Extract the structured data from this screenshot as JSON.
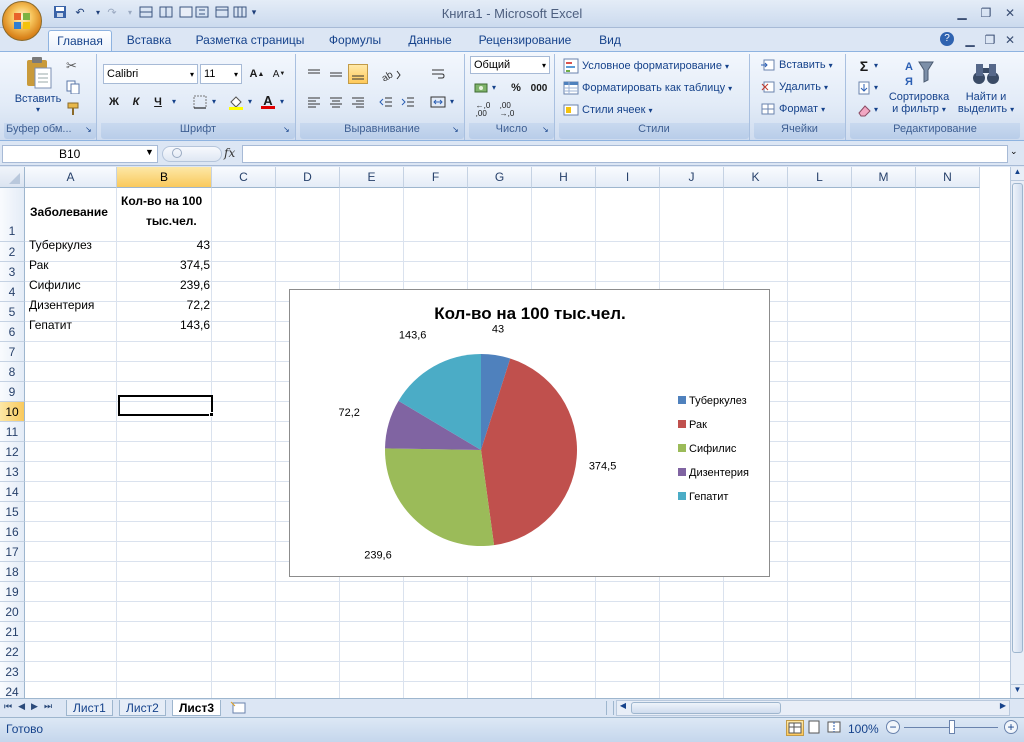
{
  "window": {
    "title": "Книга1 - Microsoft Excel"
  },
  "ribbon_tabs": [
    "Главная",
    "Вставка",
    "Разметка страницы",
    "Формулы",
    "Данные",
    "Рецензирование",
    "Вид"
  ],
  "ribbon": {
    "clipboard": {
      "paste": "Вставить",
      "label": "Буфер обм..."
    },
    "font": {
      "name": "Calibri",
      "size": "11",
      "bold": "Ж",
      "italic": "К",
      "underline": "Ч",
      "label": "Шрифт"
    },
    "alignment": {
      "label": "Выравнивание"
    },
    "number": {
      "format": "Общий",
      "percent": "%",
      "thousands": "000",
      "label": "Число"
    },
    "styles": {
      "conditional": "Условное форматирование",
      "as_table": "Форматировать как таблицу",
      "cell_styles": "Стили ячеек",
      "label": "Стили"
    },
    "cells": {
      "insert": "Вставить",
      "delete": "Удалить",
      "format": "Формат",
      "label": "Ячейки"
    },
    "editing": {
      "sort_line1": "Сортировка",
      "sort_line2": "и фильтр",
      "find_line1": "Найти и",
      "find_line2": "выделить",
      "label": "Редактирование",
      "sigma": "Σ"
    }
  },
  "formula_bar": {
    "name_box": "B10",
    "fx": "fx",
    "value": ""
  },
  "columns": [
    "A",
    "B",
    "C",
    "D",
    "E",
    "F",
    "G",
    "H",
    "I",
    "J",
    "K",
    "L",
    "M",
    "N"
  ],
  "rows": [
    "1",
    "2",
    "3",
    "4",
    "5",
    "6",
    "7",
    "8",
    "9",
    "10",
    "11",
    "12",
    "13",
    "14",
    "15",
    "16",
    "17",
    "18",
    "19",
    "20",
    "21",
    "22",
    "23",
    "24"
  ],
  "cells": {
    "A1": "Заболевание",
    "B1_line1": "Кол-во на 100",
    "B1_line2": "тыс.чел.",
    "A2": "Туберкулез",
    "B2": "43",
    "A3": "Рак",
    "B3": "374,5",
    "A4": "Сифилис",
    "B4": "239,6",
    "A5": "Дизентерия",
    "B5": "72,2",
    "A6": "Гепатит",
    "B6": "143,6"
  },
  "selected_cell": "B10",
  "chart_data": {
    "type": "pie",
    "title": "Кол-во на 100 тыс.чел.",
    "categories": [
      "Туберкулез",
      "Рак",
      "Сифилис",
      "Дизентерия",
      "Гепатит"
    ],
    "values": [
      43,
      374.5,
      239.6,
      72.2,
      143.6
    ],
    "data_labels": [
      "43",
      "374,5",
      "239,6",
      "72,2",
      "143,6"
    ],
    "colors": [
      "#4f81bd",
      "#c0504d",
      "#9bbb59",
      "#8064a2",
      "#4bacc6"
    ],
    "legend_position": "right"
  },
  "sheets": [
    "Лист1",
    "Лист2",
    "Лист3"
  ],
  "active_sheet": "Лист3",
  "status": {
    "ready": "Готово",
    "zoom": "100%"
  }
}
